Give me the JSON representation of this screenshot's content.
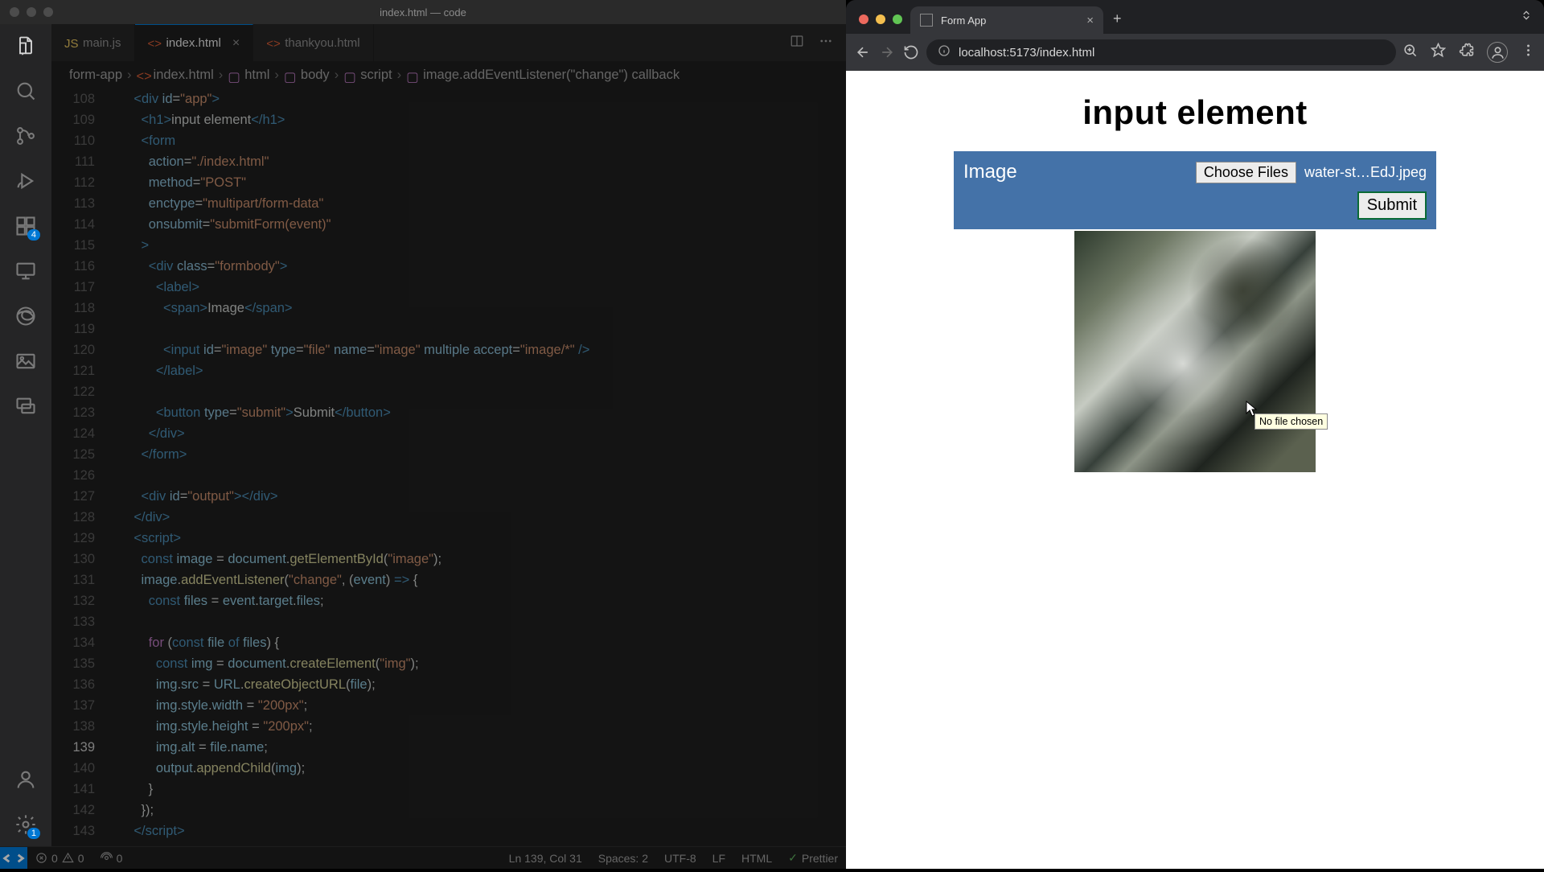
{
  "vscode": {
    "title": "index.html — code",
    "tabs": [
      {
        "label": "main.js",
        "kind": "js"
      },
      {
        "label": "index.html",
        "kind": "html",
        "active": true
      },
      {
        "label": "thankyou.html",
        "kind": "html"
      }
    ],
    "breadcrumb": {
      "root": "form-app",
      "file": "index.html",
      "path": [
        "html",
        "body",
        "script",
        "image.addEventListener(\"change\") callback"
      ]
    },
    "extensions_badge": "4",
    "remote_badge": "1",
    "lines_start": 108,
    "lines_end": 143,
    "highlight_line": 139,
    "status": {
      "errors": "0",
      "warnings": "0",
      "ports": "0",
      "ln_col": "Ln 139, Col 31",
      "spaces": "Spaces: 2",
      "encoding": "UTF-8",
      "eol": "LF",
      "lang": "HTML",
      "formatter": "Prettier"
    }
  },
  "browser": {
    "tab_title": "Form App",
    "url": "localhost:5173/index.html",
    "page": {
      "heading": "input element",
      "label": "Image",
      "choose_button": "Choose Files",
      "file_name": "water-st…EdJ.jpeg",
      "submit": "Submit",
      "tooltip": "No file chosen"
    }
  }
}
